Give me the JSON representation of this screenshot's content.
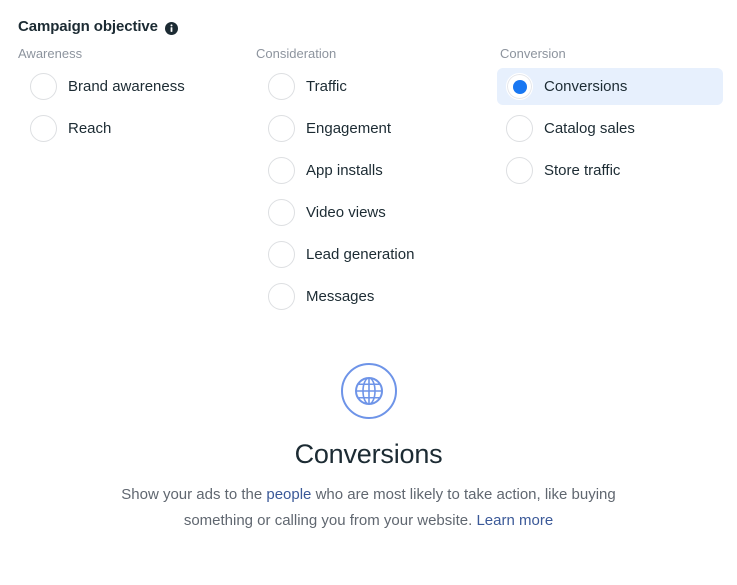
{
  "header": {
    "title": "Campaign objective",
    "info_icon": "info-icon",
    "info_tooltip": "Campaign objective"
  },
  "colors": {
    "accent": "#1877f2",
    "selected_row_background": "#e7f0fd",
    "link": "#3b5998",
    "glyph": "#6e94e8",
    "muted_text": "#8d949e",
    "body_text": "#1c2b33",
    "description_text": "#606770",
    "radio_border": "#dddfe2",
    "page_background": "#ffffff"
  },
  "columns": [
    {
      "header": "Awareness",
      "options": [
        {
          "label": "Brand awareness",
          "selected": false
        },
        {
          "label": "Reach",
          "selected": false
        }
      ]
    },
    {
      "header": "Consideration",
      "options": [
        {
          "label": "Traffic",
          "selected": false
        },
        {
          "label": "Engagement",
          "selected": false
        },
        {
          "label": "App installs",
          "selected": false
        },
        {
          "label": "Video views",
          "selected": false
        },
        {
          "label": "Lead generation",
          "selected": false
        },
        {
          "label": "Messages",
          "selected": false
        }
      ]
    },
    {
      "header": "Conversion",
      "options": [
        {
          "label": "Conversions",
          "selected": true
        },
        {
          "label": "Catalog sales",
          "selected": false
        },
        {
          "label": "Store traffic",
          "selected": false
        }
      ]
    }
  ],
  "detail": {
    "icon": "globe-icon",
    "title": "Conversions",
    "description_parts": [
      {
        "type": "text",
        "text": "Show your ads to the "
      },
      {
        "type": "link",
        "text": "people"
      },
      {
        "type": "text",
        "text": " who are most likely to take action, like buying something or calling you from your website. "
      },
      {
        "type": "link",
        "text": "Learn more"
      }
    ]
  }
}
